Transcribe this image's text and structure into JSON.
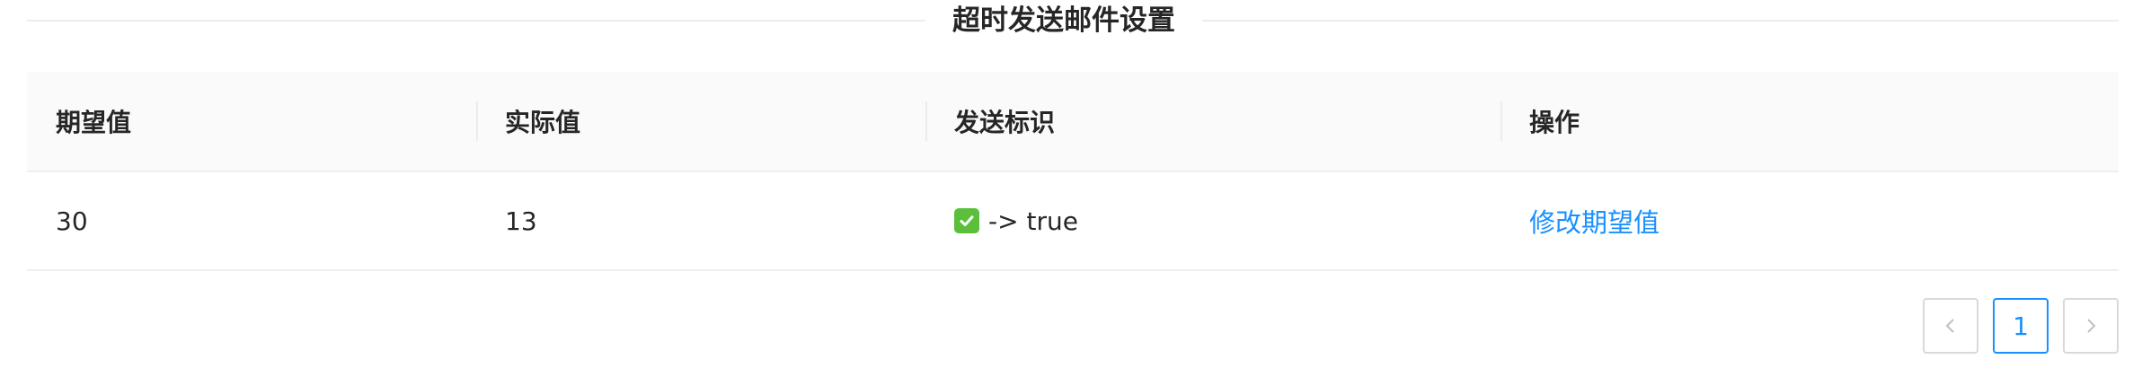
{
  "section": {
    "title": "超时发送邮件设置"
  },
  "table": {
    "columns": [
      "期望值",
      "实际值",
      "发送标识",
      "操作"
    ],
    "rows": [
      {
        "expected": "30",
        "actual": "13",
        "flag_text": "-> true",
        "flag_icon": "check-mark-icon",
        "action": "修改期望值"
      }
    ]
  },
  "pagination": {
    "current_page": "1",
    "prev_icon": "chevron-left-icon",
    "next_icon": "chevron-right-icon"
  },
  "colors": {
    "accent": "#1890ff",
    "header_bg": "#fafafa",
    "check_green": "#5bbf3c"
  }
}
